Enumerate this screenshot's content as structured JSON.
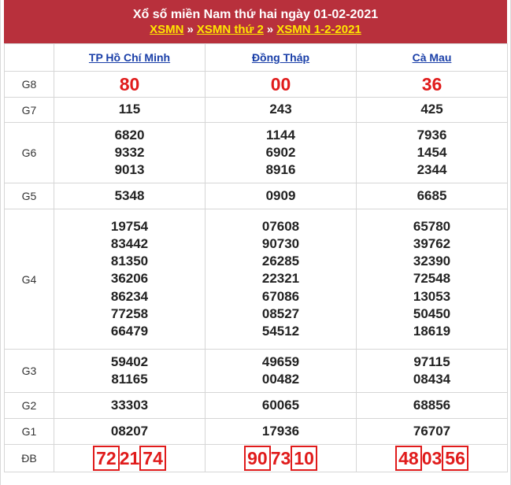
{
  "header": {
    "title": "Xổ số miền Nam thứ hai ngày 01-02-2021",
    "crumbs": [
      "XSMN",
      "XSMN thứ 2",
      "XSMN 1-2-2021"
    ],
    "separator": "»"
  },
  "provinces": [
    "TP Hồ Chí Minh",
    "Đồng Tháp",
    "Cà Mau"
  ],
  "prizes": [
    {
      "label": "G8",
      "values": [
        [
          "80"
        ],
        [
          "00"
        ],
        [
          "36"
        ]
      ]
    },
    {
      "label": "G7",
      "values": [
        [
          "115"
        ],
        [
          "243"
        ],
        [
          "425"
        ]
      ]
    },
    {
      "label": "G6",
      "values": [
        [
          "6820",
          "9332",
          "9013"
        ],
        [
          "1144",
          "6902",
          "8916"
        ],
        [
          "7936",
          "1454",
          "2344"
        ]
      ]
    },
    {
      "label": "G5",
      "values": [
        [
          "5348"
        ],
        [
          "0909"
        ],
        [
          "6685"
        ]
      ]
    },
    {
      "label": "G4",
      "values": [
        [
          "19754",
          "83442",
          "81350",
          "36206",
          "86234",
          "77258",
          "66479"
        ],
        [
          "07608",
          "90730",
          "26285",
          "22321",
          "67086",
          "08527",
          "54512"
        ],
        [
          "65780",
          "39762",
          "32390",
          "72548",
          "13053",
          "50450",
          "18619"
        ]
      ]
    },
    {
      "label": "G3",
      "values": [
        [
          "59402",
          "81165"
        ],
        [
          "49659",
          "00482"
        ],
        [
          "97115",
          "08434"
        ]
      ]
    },
    {
      "label": "G2",
      "values": [
        [
          "33303"
        ],
        [
          "60065"
        ],
        [
          "68856"
        ]
      ]
    },
    {
      "label": "G1",
      "values": [
        [
          "08207"
        ],
        [
          "17936"
        ],
        [
          "76707"
        ]
      ]
    },
    {
      "label": "ĐB",
      "values": [
        [
          "722174"
        ],
        [
          "907310"
        ],
        [
          "480356"
        ]
      ]
    }
  ],
  "colors": {
    "header_bg": "#b8303c",
    "link": "#ffe600",
    "highlight": "#e01b1b"
  }
}
